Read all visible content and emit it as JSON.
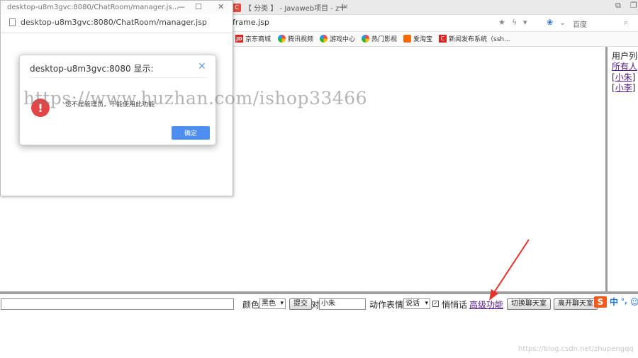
{
  "browser": {
    "tabs": [
      {
        "label": "【 分类 】 - Javaweb项目 - z"
      }
    ],
    "url_fragment": "frame.jsp",
    "search_engine": "百度",
    "bookmarks": [
      {
        "icon": "jd-icon",
        "label": "京东商城"
      },
      {
        "icon": "video-icon",
        "label": "腾讯视频"
      },
      {
        "icon": "game-icon",
        "label": "游戏中心"
      },
      {
        "icon": "film-icon",
        "label": "热门影视"
      },
      {
        "icon": "taobao-icon",
        "label": "爱淘宝"
      },
      {
        "icon": "news-icon",
        "label": "新闻发布系统（ssh..."
      }
    ]
  },
  "popup_window": {
    "title": "desktop-u8m3gvc:8080/ChatRoom/manager.js...",
    "url": "desktop-u8m3gvc:8080/ChatRoom/manager.jsp"
  },
  "dialog": {
    "title": "desktop-u8m3gvc:8080 显示:",
    "message": "您不是管理员，不能使用此功能",
    "ok_label": "确定",
    "icon": "error-icon"
  },
  "user_list": {
    "title": "用户列表",
    "items": [
      "所有人",
      "小朱",
      "小李"
    ]
  },
  "chat_toolbar": {
    "message_value": "",
    "color_label": "颜色",
    "color_value": "黑色",
    "submit_label": "提交",
    "to_label": "对",
    "to_value": "小朱",
    "action_label": "动作表情",
    "action_value": "说话",
    "whisper_label": "悄悄话",
    "whisper_checked": true,
    "advanced_label": "高级功能",
    "switch_room_label": "切换聊天室",
    "leave_room_label": "离开聊天室"
  },
  "ime": {
    "mode_label": "中"
  },
  "watermark": "https://www.huzhan.com/ishop33466",
  "footer_credit": "https://blog.csdn.net/zhupengqq",
  "colors": {
    "accent": "#4c8ff0",
    "error": "#e34646",
    "link": "#551a8b",
    "arrow": "#e8322a"
  }
}
